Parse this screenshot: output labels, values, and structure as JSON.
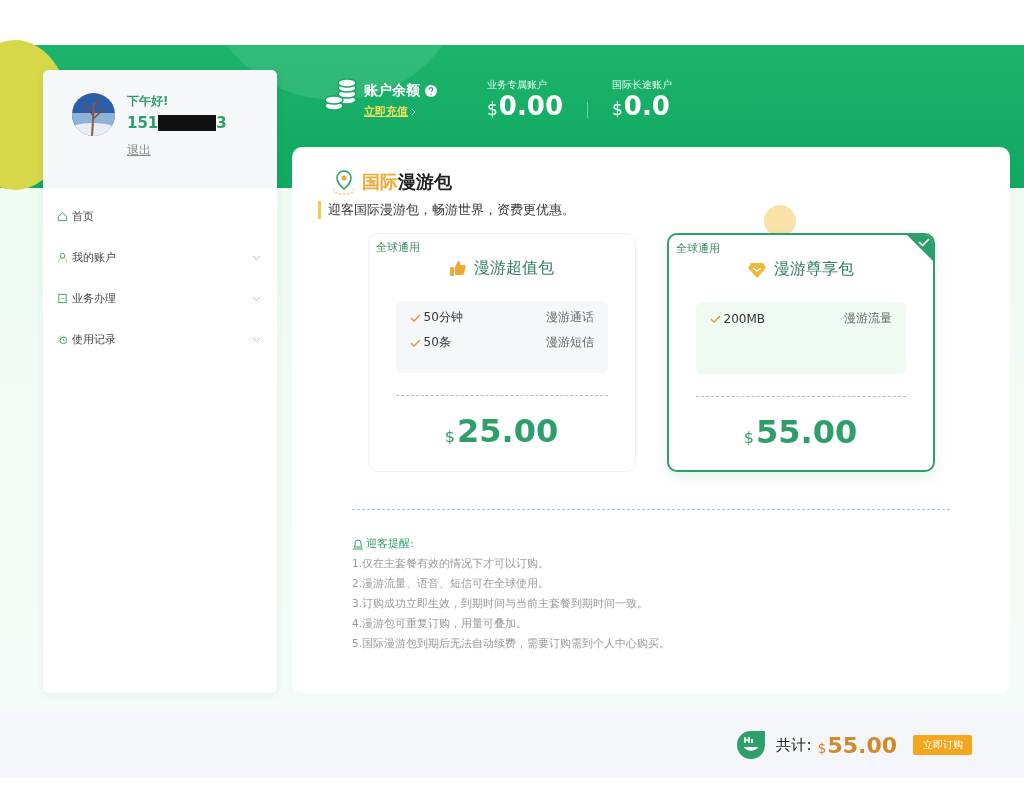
{
  "user": {
    "greeting": "下午好!",
    "phone_start": "151",
    "phone_end": "3",
    "logout": "退出"
  },
  "sidebar": {
    "items": [
      {
        "label": "首页",
        "kind": "home",
        "has_chevron": false
      },
      {
        "label": "我的账户",
        "kind": "user",
        "has_chevron": true
      },
      {
        "label": "业务办理",
        "kind": "doc",
        "has_chevron": true
      },
      {
        "label": "使用记录",
        "kind": "clock",
        "has_chevron": true
      }
    ]
  },
  "balance": {
    "title": "账户余额",
    "recharge": "立即充值",
    "accounts": [
      {
        "label": "业务专属账户",
        "currency": "$",
        "amount": "0.00"
      },
      {
        "label": "国际长途账户",
        "currency": "$",
        "amount": "0.0"
      }
    ]
  },
  "section": {
    "title_accent": "国际",
    "title_rest": "漫游包",
    "subtitle": "迎客国际漫游包，畅游世界，资费更优惠。"
  },
  "packages": [
    {
      "tag": "全球通用",
      "name": "漫游超值包",
      "kind": "thumb",
      "features": [
        {
          "value": "50分钟",
          "label": "漫游通话"
        },
        {
          "value": "50条",
          "label": "漫游短信"
        }
      ],
      "currency": "$",
      "price": "25.00",
      "selected": false
    },
    {
      "tag": "全球通用",
      "name": "漫游尊享包",
      "kind": "gem",
      "features": [
        {
          "value": "200MB",
          "label": "漫游流量"
        }
      ],
      "currency": "$",
      "price": "55.00",
      "selected": true
    }
  ],
  "notice": {
    "title": "迎客提醒:",
    "items": [
      "1.仅在主套餐有效的情况下才可以订购。",
      "2.漫游流量、语音、短信可在全球使用。",
      "3.订购成功立即生效，到期时间与当前主套餐到期时间一致。",
      "4.漫游包可重复订购，用量可叠加。",
      "5.国际漫游包到期后无法自动续费，需要订购需到个人中心购买。"
    ]
  },
  "footer": {
    "total_label": "共计:",
    "currency": "$",
    "total": "55.00",
    "button": "立即订购"
  }
}
